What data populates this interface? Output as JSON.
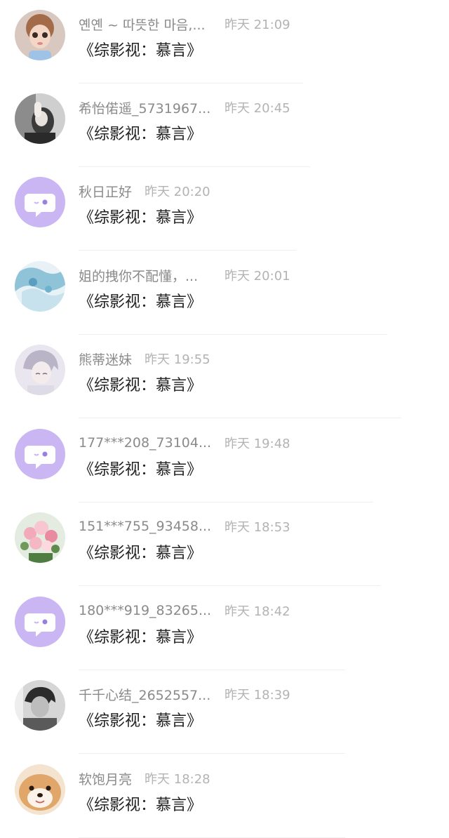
{
  "conversations": [
    {
      "name": "옌옌 ~ 따뜻한 마음,...",
      "time": "昨天 21:09",
      "message": "《综影视：慕言》",
      "avatar": "avatar-photo-doll"
    },
    {
      "name": "希怡偌遥_5731967...",
      "time": "昨天 20:45",
      "message": "《综影视：慕言》",
      "avatar": "avatar-photo-person"
    },
    {
      "name": "秋日正好",
      "time": "昨天 20:20",
      "message": "《综影视：慕言》",
      "avatar": "default-chat-bubble-icon"
    },
    {
      "name": "姐的拽你不配懂，...",
      "time": "昨天 20:01",
      "message": "《综影视：慕言》",
      "avatar": "avatar-photo-blue-art"
    },
    {
      "name": "熊蒂迷妹",
      "time": "昨天 19:55",
      "message": "《综影视：慕言》",
      "avatar": "avatar-photo-anime-boy"
    },
    {
      "name": "177***208_73104...",
      "time": "昨天 19:48",
      "message": "《综影视：慕言》",
      "avatar": "default-chat-bubble-icon"
    },
    {
      "name": "151***755_93458...",
      "time": "昨天 18:53",
      "message": "《综影视：慕言》",
      "avatar": "avatar-photo-flowers"
    },
    {
      "name": "180***919_83265...",
      "time": "昨天 18:42",
      "message": "《综影视：慕言》",
      "avatar": "default-chat-bubble-icon"
    },
    {
      "name": "千千心结_2652557...",
      "time": "昨天 18:39",
      "message": "《综影视：慕言》",
      "avatar": "avatar-photo-bw-person"
    },
    {
      "name": "软饱月亮",
      "time": "昨天 18:28",
      "message": "《综影视：慕言》",
      "avatar": "avatar-photo-dog"
    }
  ],
  "colors": {
    "name_text": "#8a8a8a",
    "time_text": "#b3b3b3",
    "message_text": "#222222",
    "default_avatar_bg": "#c9b6f3",
    "divider": "#efefef"
  }
}
